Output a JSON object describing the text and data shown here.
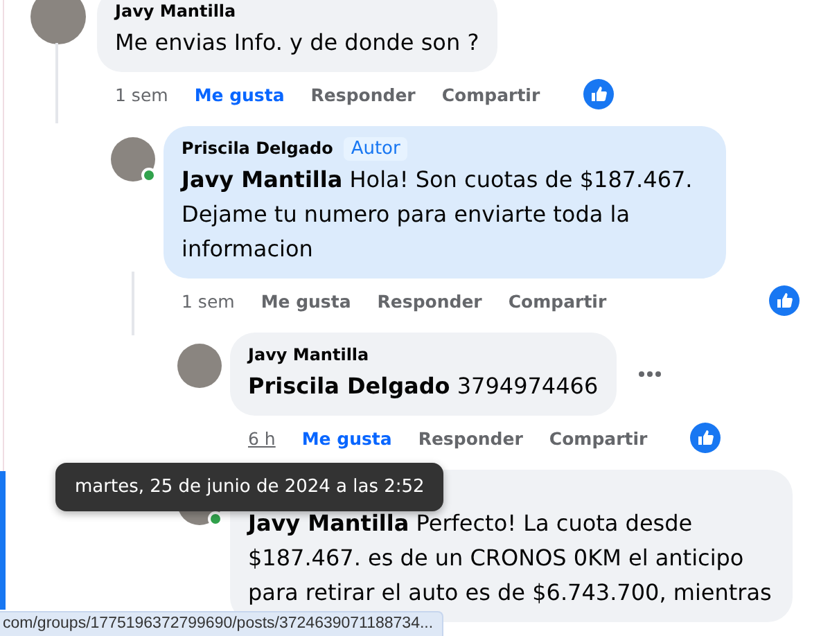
{
  "comments": [
    {
      "author": "Javy Mantilla",
      "text": "Me envias Info. y de donde son ?",
      "highlighted": false,
      "time": {
        "label": "1 sem",
        "hovered": false
      },
      "actions": [
        {
          "label": "Me gusta",
          "selected": true
        },
        {
          "label": "Responder",
          "selected": false
        },
        {
          "label": "Compartir",
          "selected": false
        }
      ],
      "reaction": true,
      "children": [
        {
          "author": "Priscila Delgado",
          "badge": "Autor",
          "text": "**Javy Mantilla** Hola! Son cuotas de $187.467. Dejame tu numero para enviarte toda la informacion",
          "online": true,
          "highlighted": true,
          "time": {
            "label": "1 sem",
            "hovered": false
          },
          "actions": [
            {
              "label": "Me gusta",
              "selected": false
            },
            {
              "label": "Responder",
              "selected": false
            },
            {
              "label": "Compartir",
              "selected": false
            }
          ],
          "reaction": true,
          "children": [
            {
              "author": "Javy Mantilla",
              "text": "**Priscila Delgado** 3794974466",
              "highlighted": false,
              "menu": true,
              "time": {
                "label": "6 h",
                "hovered": true
              },
              "actions": [
                {
                  "label": "Me gusta",
                  "selected": true
                },
                {
                  "label": "Responder",
                  "selected": false
                },
                {
                  "label": "Compartir",
                  "selected": false
                }
              ],
              "reaction": true
            },
            {
              "text": "**Javy Mantilla** Perfecto! La cuota desde $187.467. es de un CRONOS 0KM el anticipo para retirar el auto es de $6.743.700, mientras",
              "online": true,
              "highlighted": false
            }
          ]
        }
      ]
    }
  ],
  "tooltip": "martes, 25 de junio de 2024 a las 2:52",
  "status_url": "com/groups/1775196372799690/posts/3724639071188734..."
}
